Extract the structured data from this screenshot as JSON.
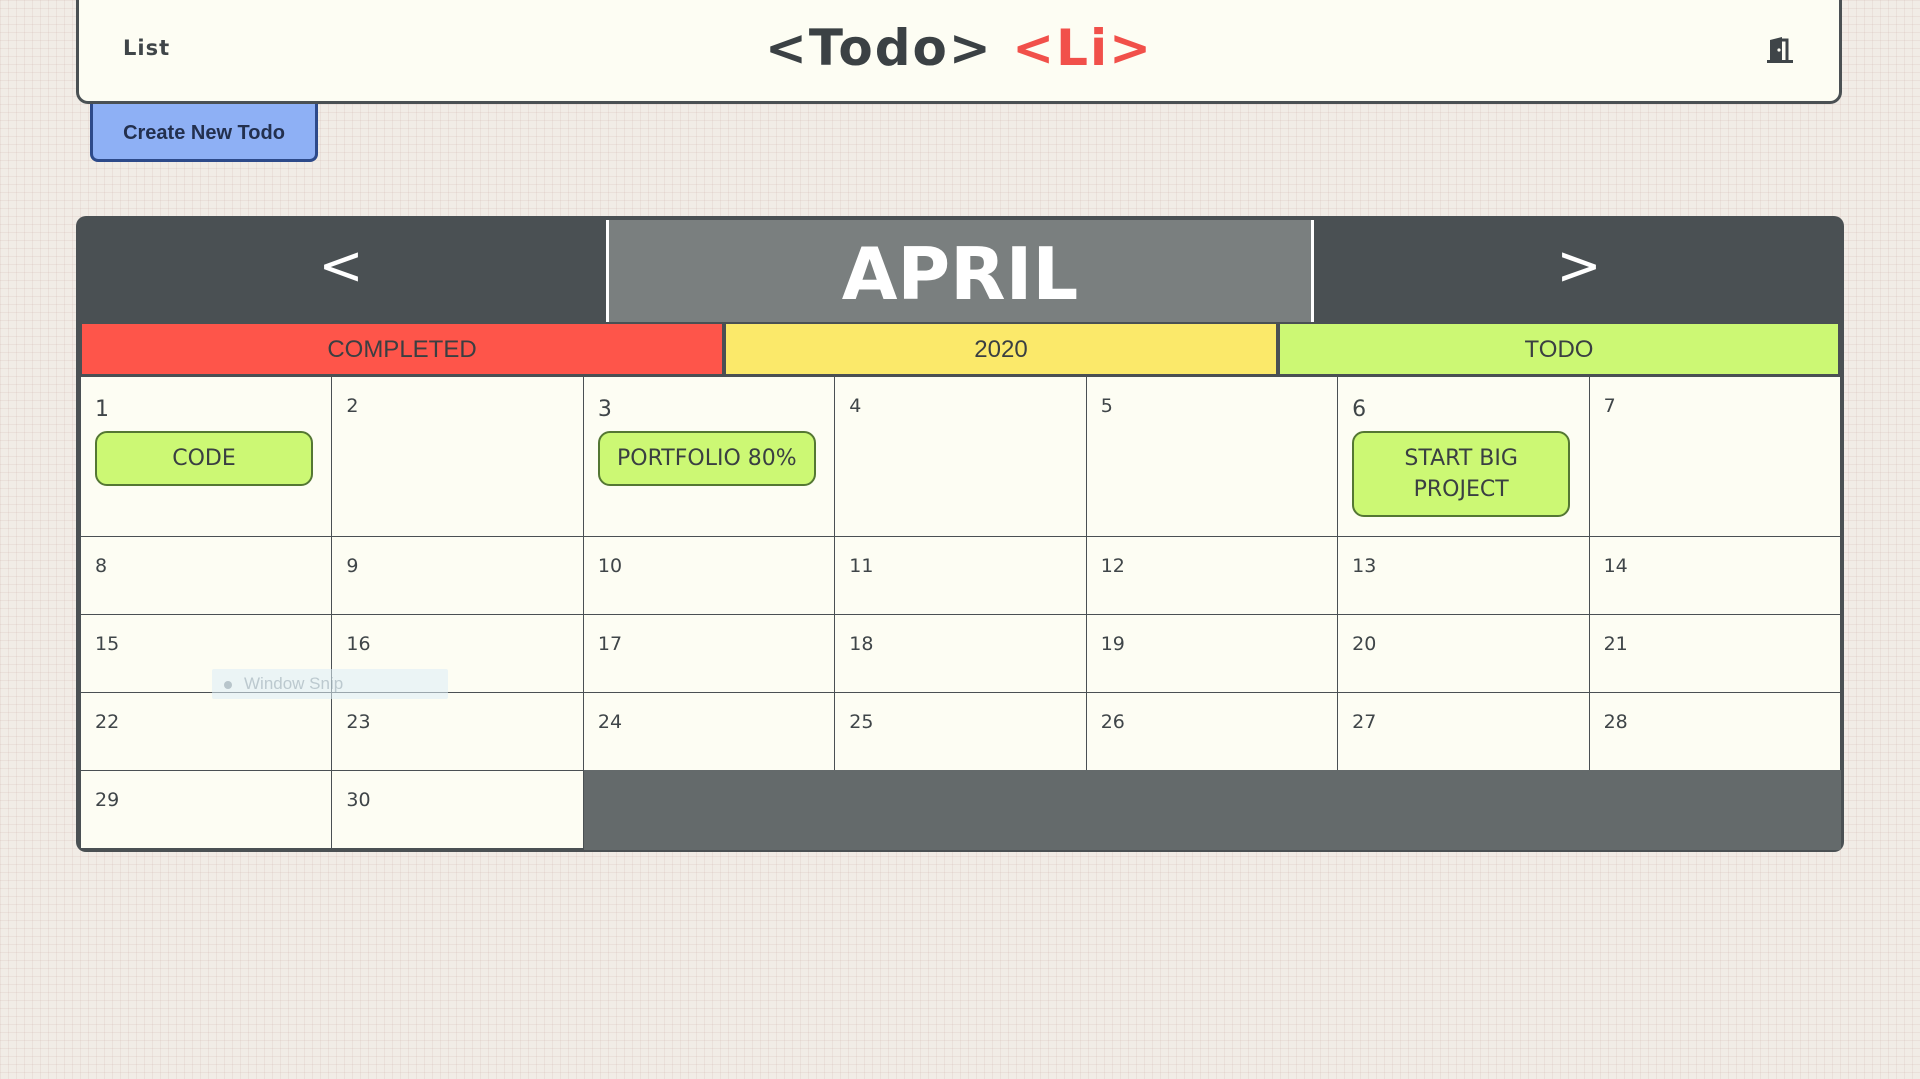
{
  "header": {
    "list_label": "List",
    "logo": {
      "part1": "<Todo>",
      "part2": "<Li>"
    },
    "logout_icon": "door-icon"
  },
  "actions": {
    "create_label": "Create New Todo"
  },
  "calendar": {
    "prev_label": "<",
    "next_label": ">",
    "month": "APRIL",
    "year": "2020",
    "completed_label": "COMPLETED",
    "todo_label": "TODO",
    "days": [
      {
        "num": "1",
        "todos": [
          "CODE"
        ]
      },
      {
        "num": "2",
        "todos": []
      },
      {
        "num": "3",
        "todos": [
          "PORTFOLIO 80%"
        ]
      },
      {
        "num": "4",
        "todos": []
      },
      {
        "num": "5",
        "todos": []
      },
      {
        "num": "6",
        "todos": [
          "START BIG PROJECT"
        ]
      },
      {
        "num": "7",
        "todos": []
      },
      {
        "num": "8"
      },
      {
        "num": "9"
      },
      {
        "num": "10"
      },
      {
        "num": "11"
      },
      {
        "num": "12"
      },
      {
        "num": "13"
      },
      {
        "num": "14"
      },
      {
        "num": "15"
      },
      {
        "num": "16"
      },
      {
        "num": "17"
      },
      {
        "num": "18"
      },
      {
        "num": "19"
      },
      {
        "num": "20"
      },
      {
        "num": "21"
      },
      {
        "num": "22"
      },
      {
        "num": "23"
      },
      {
        "num": "24"
      },
      {
        "num": "25"
      },
      {
        "num": "26"
      },
      {
        "num": "27"
      },
      {
        "num": "28"
      },
      {
        "num": "29"
      },
      {
        "num": "30"
      }
    ]
  },
  "overlay": {
    "tooltip_text": "Window Snip"
  },
  "colors": {
    "completed": "#fe554a",
    "year": "#fbe96a",
    "todo": "#ccf874",
    "nav_dark": "#4a5053",
    "month_box": "#7a7f7f",
    "create_button": "#8eb0f5",
    "logo_accent": "#f1504a"
  }
}
